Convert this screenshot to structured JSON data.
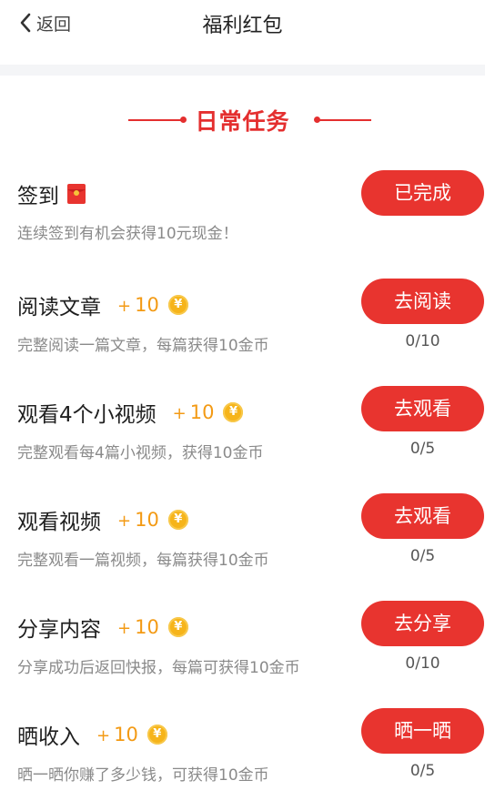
{
  "header": {
    "back_label": "返回",
    "title": "福利红包"
  },
  "section": {
    "title": "日常任务"
  },
  "tasks": [
    {
      "title": "签到",
      "reward": "",
      "desc": "连续签到有机会获得10元现金！",
      "button": "已完成",
      "progress": "",
      "icon": "red-packet-icon"
    },
    {
      "title": "阅读文章",
      "reward": "10",
      "desc": "完整阅读一篇文章，每篇获得10金币",
      "button": "去阅读",
      "progress": "0/10",
      "icon": "coin-icon"
    },
    {
      "title": "观看4个小视频",
      "reward": "10",
      "desc": "完整观看每4篇小视频，获得10金币",
      "button": "去观看",
      "progress": "0/5",
      "icon": "coin-icon"
    },
    {
      "title": "观看视频",
      "reward": "10",
      "desc": "完整观看一篇视频，每篇获得10金币",
      "button": "去观看",
      "progress": "0/5",
      "icon": "coin-icon"
    },
    {
      "title": "分享内容",
      "reward": "10",
      "desc": "分享成功后返回快报，每篇可获得10金币",
      "button": "去分享",
      "progress": "0/10",
      "icon": "coin-icon"
    },
    {
      "title": "晒收入",
      "reward": "10",
      "desc": "晒一晒你赚了多少钱，可获得10金币",
      "button": "晒一晒",
      "progress": "0/5",
      "icon": "coin-icon"
    }
  ],
  "colors": {
    "accent": "#e8342f",
    "reward": "#f39a14",
    "coin": "#f6b41a"
  }
}
